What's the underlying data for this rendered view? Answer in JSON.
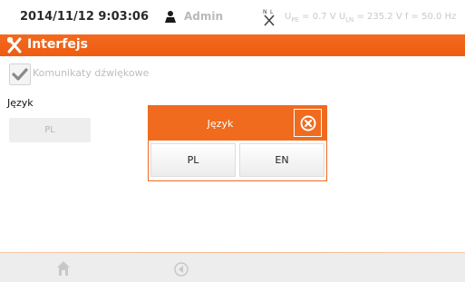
{
  "status": {
    "datetime": "2014/11/12 9:03:06",
    "user": "Admin",
    "u_peb_label": "U",
    "u_peb_sub": "PE",
    "u_peb_value": " = 0.7 V ",
    "u_ln_label": "U",
    "u_ln_sub": "LN",
    "u_ln_value": " = 235.2 V f = 50.0 Hz",
    "icons": {
      "user": "user-icon",
      "plug": "plug-icon"
    }
  },
  "title": {
    "text": "Interfejs",
    "icon": "tools-icon"
  },
  "settings": {
    "sound_checked": true,
    "sound_label": "Komunikaty dźwiękowe",
    "language_heading": "Język",
    "language_value": "PL"
  },
  "dialog": {
    "title": "Język",
    "close_icon": "close-icon",
    "options": [
      "PL",
      "EN"
    ]
  },
  "bottom": {
    "icons": [
      "home-icon",
      "back-icon"
    ]
  },
  "colors": {
    "accent": "#f06b1e",
    "title_bar": "#ee5c10"
  }
}
